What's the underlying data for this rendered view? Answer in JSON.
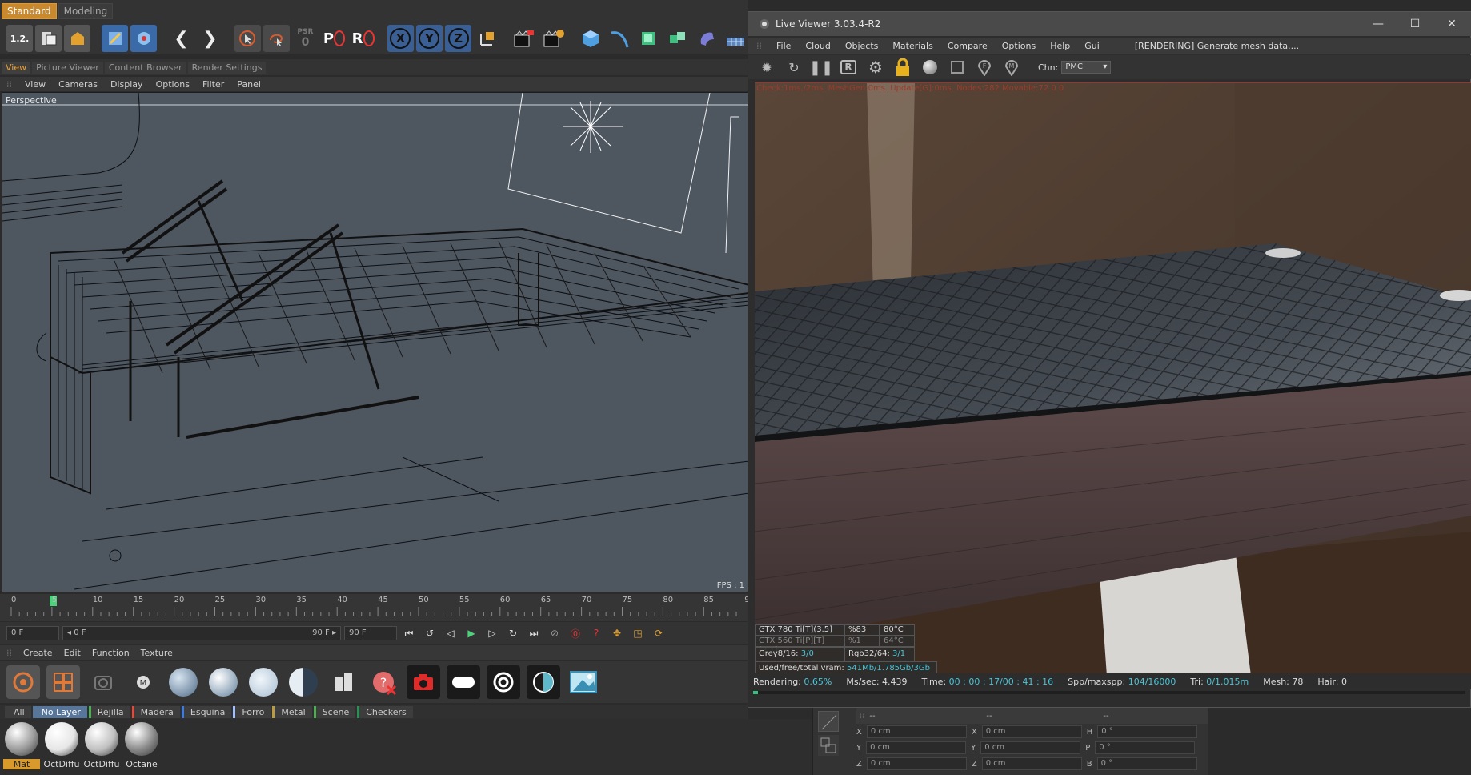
{
  "layout_tabs": {
    "standard": "Standard",
    "modeling": "Modeling"
  },
  "toolbar": {
    "undo_label": "1.2.",
    "psr_label": "PSR",
    "psr_value": "0",
    "pos_label": "P",
    "rot_label": "R",
    "axis_x": "X",
    "axis_y": "Y",
    "axis_z": "Z"
  },
  "panel_tabs": [
    "View",
    "Picture Viewer",
    "Content Browser",
    "Render Settings"
  ],
  "viewport_menu": [
    "View",
    "Cameras",
    "Display",
    "Options",
    "Filter",
    "Panel"
  ],
  "viewport": {
    "label": "Perspective",
    "fps": "FPS : 1"
  },
  "timeline": {
    "ticks": [
      "0",
      "5",
      "10",
      "15",
      "20",
      "25",
      "30",
      "35",
      "40",
      "45",
      "50",
      "55",
      "60",
      "65",
      "70",
      "75",
      "80",
      "85",
      "9"
    ],
    "current_frame": "0 F",
    "range_start": "◂ 0 F",
    "range_end": "90 F ▸",
    "end_frame": "90 F"
  },
  "material_menu": [
    "Create",
    "Edit",
    "Function",
    "Texture"
  ],
  "material_layers": [
    {
      "label": "All",
      "color": ""
    },
    {
      "label": "No Layer",
      "color": ""
    },
    {
      "label": "Rejilla",
      "color": "#4caf50"
    },
    {
      "label": "Madera",
      "color": "#e04b3a"
    },
    {
      "label": "Esquina",
      "color": "#3f7bd8"
    },
    {
      "label": "Forro",
      "color": "#9ec0ff"
    },
    {
      "label": "Metal",
      "color": "#ba9b40"
    },
    {
      "label": "Scene",
      "color": "#4caf50"
    },
    {
      "label": "Checkers",
      "color": "#2d8f55"
    }
  ],
  "materials": [
    {
      "name": "Mat",
      "color": "#9a9a9a"
    },
    {
      "name": "OctDiffu",
      "color": "#e6e6e6"
    },
    {
      "name": "OctDiffu",
      "color": "#c0c0c0"
    },
    {
      "name": "Octane",
      "color": "#888888"
    }
  ],
  "coordinates": {
    "header": [
      "--",
      "--",
      "--"
    ],
    "rows": [
      {
        "a": "X",
        "av": "0 cm",
        "b": "X",
        "bv": "0 cm",
        "c": "H",
        "cv": "0 °"
      },
      {
        "a": "Y",
        "av": "0 cm",
        "b": "Y",
        "bv": "0 cm",
        "c": "P",
        "cv": "0 °"
      },
      {
        "a": "Z",
        "av": "0 cm",
        "b": "Z",
        "bv": "0 cm",
        "c": "B",
        "cv": "0 °"
      }
    ]
  },
  "live_viewer": {
    "title": "Live Viewer 3.03.4-R2",
    "menu": [
      "File",
      "Cloud",
      "Objects",
      "Materials",
      "Compare",
      "Options",
      "Help",
      "Gui"
    ],
    "status": "[RENDERING] Generate mesh data....",
    "channel_label": "Chn:",
    "channel_value": "PMC",
    "check_line": "Check:1ms./2ms. MeshGen:0ms. Update[G]:0ms. Nodes:282 Movable:72  0 0",
    "gpus": [
      {
        "name": "GTX 780 Ti[T](3.5]",
        "usage": "%83",
        "temp": "80°C"
      },
      {
        "name": "GTX 560 Ti[P][T](2.1]",
        "usage": "%1",
        "temp": "64°C"
      }
    ],
    "grey_label": "Grey8/16:",
    "grey_value": "3/0",
    "rgb_label": "Rgb32/64:",
    "rgb_value": "3/1",
    "vram_label": "Used/free/total vram:",
    "vram_value": "541Mb/1.785Gb/3Gb",
    "footer": {
      "rendering_label": "Rendering:",
      "rendering_value": "0.65%",
      "mssec_label": "Ms/sec:",
      "mssec_value": "4.439",
      "time_label": "Time:",
      "time_value": "00 : 00 : 17/00 : 41 : 16",
      "spp_label": "Spp/maxspp:",
      "spp_value": "104/16000",
      "tri_label": "Tri:",
      "tri_value": "0/1.015m",
      "mesh_label": "Mesh:",
      "mesh_value": "78",
      "hair_label": "Hair:",
      "hair_value": "0"
    },
    "progress_fraction": 0.0065
  },
  "colors": {
    "accent": "#c9892c",
    "viewport_bg": "#4e5660",
    "status_cyan": "#48c6d9",
    "progress": "#2ec27c"
  }
}
